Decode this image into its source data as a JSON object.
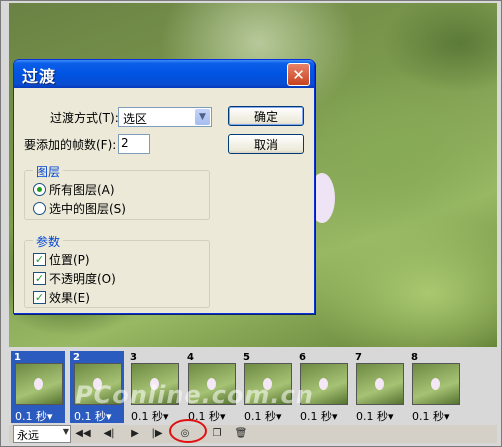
{
  "dialog": {
    "title": "过渡",
    "close_glyph": "✕",
    "transition_label": "过渡方式(T):",
    "transition_value": "选区",
    "frames_label": "要添加的帧数(F):",
    "frames_value": "2",
    "ok_label": "确定",
    "cancel_label": "取消",
    "layers_group": {
      "title": "图层",
      "options": [
        "所有图层(A)",
        "选中的图层(S)"
      ],
      "selected": 0
    },
    "params_group": {
      "title": "参数",
      "options": [
        "位置(P)",
        "不透明度(O)",
        "效果(E)"
      ],
      "checked": [
        true,
        true,
        true
      ]
    }
  },
  "frames": [
    {
      "num": "1",
      "duration": "0.1 秒▾",
      "selected": true
    },
    {
      "num": "2",
      "duration": "0.1 秒▾",
      "selected": true
    },
    {
      "num": "3",
      "duration": "0.1 秒▾",
      "selected": false
    },
    {
      "num": "4",
      "duration": "0.1 秒▾",
      "selected": false
    },
    {
      "num": "5",
      "duration": "0.1 秒▾",
      "selected": false
    },
    {
      "num": "6",
      "duration": "0.1 秒▾",
      "selected": false
    },
    {
      "num": "7",
      "duration": "0.1 秒▾",
      "selected": false
    },
    {
      "num": "8",
      "duration": "0.1 秒▾",
      "selected": false
    }
  ],
  "toolbar": {
    "loop_value": "永远",
    "buttons": [
      {
        "name": "first-frame-icon",
        "glyph": "◀◀"
      },
      {
        "name": "prev-frame-icon",
        "glyph": "◀|"
      },
      {
        "name": "play-icon",
        "glyph": "▶"
      },
      {
        "name": "next-frame-icon",
        "glyph": "|▶"
      },
      {
        "name": "tween-icon",
        "glyph": "◎"
      },
      {
        "name": "new-frame-icon",
        "glyph": "❐"
      },
      {
        "name": "delete-frame-icon",
        "glyph": "🗑"
      }
    ]
  },
  "watermark": "PConline.com.cn",
  "colors": {
    "accent": "#0054e3",
    "selection": "#2c5bbf",
    "highlight_circle": "#e01010"
  }
}
